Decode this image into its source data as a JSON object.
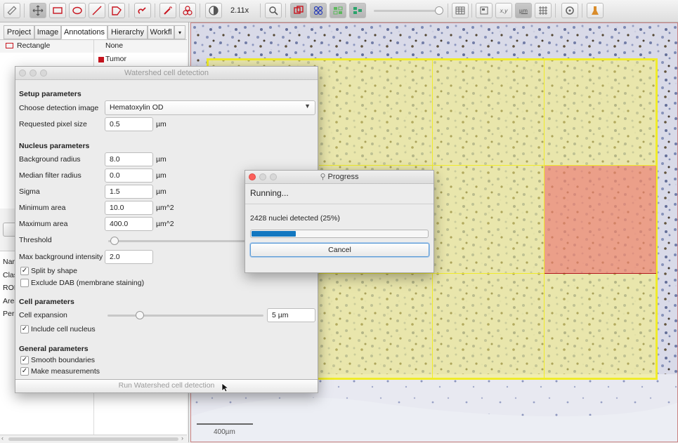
{
  "toolbar": {
    "zoom_label": "2.11x",
    "coord_label": "x,y",
    "unit_label": "µm",
    "icons": [
      "ruler-icon",
      "move-icon",
      "rectangle-icon",
      "ellipse-icon",
      "line-icon",
      "polygon-icon",
      "brush-icon",
      "wand-icon",
      "cells-icon",
      "contrast-icon",
      "zoom-icon",
      "overlay-fill-icon",
      "overlay-detect-icon",
      "overlay-grid-icon",
      "overlay-cells-icon",
      "table-icon",
      "slide-icon",
      "coordinates-icon",
      "scale-icon",
      "grid-icon",
      "settings-icon",
      "log-icon"
    ]
  },
  "left_panel": {
    "tabs": [
      "Project",
      "Image",
      "Annotations",
      "Hierarchy",
      "Workfl"
    ],
    "active_tab": "Annotations",
    "annotation_list": [
      {
        "name": "Rectangle"
      }
    ],
    "class_list": [
      {
        "name": "None",
        "color": ""
      },
      {
        "name": "Tumor",
        "color": "#c8141e"
      }
    ],
    "measurement_stubs": [
      "Nam",
      "Clas",
      "ROI",
      "Area",
      "Peri"
    ]
  },
  "viewer": {
    "scalebar_label": "400µm"
  },
  "watershed_dialog": {
    "title": "Watershed cell detection",
    "sections": {
      "setup": "Setup parameters",
      "nucleus": "Nucleus parameters",
      "cell": "Cell parameters",
      "general": "General parameters"
    },
    "detection_image": {
      "label": "Choose detection image",
      "value": "Hematoxylin OD"
    },
    "pixel_size": {
      "label": "Requested pixel size",
      "value": "0.5",
      "unit": "µm"
    },
    "background_radius": {
      "label": "Background radius",
      "value": "8.0",
      "unit": "µm"
    },
    "median_filter": {
      "label": "Median filter radius",
      "value": "0.0",
      "unit": "µm"
    },
    "sigma": {
      "label": "Sigma",
      "value": "1.5",
      "unit": "µm"
    },
    "min_area": {
      "label": "Minimum area",
      "value": "10.0",
      "unit": "µm^2"
    },
    "max_area": {
      "label": "Maximum area",
      "value": "400.0",
      "unit": "µm^2"
    },
    "threshold": {
      "label": "Threshold"
    },
    "max_bg_intensity": {
      "label": "Max background intensity",
      "value": "2.0"
    },
    "split_by_shape": {
      "label": "Split by shape",
      "checked": true
    },
    "exclude_dab": {
      "label": "Exclude DAB (membrane staining)",
      "checked": false
    },
    "cell_expansion": {
      "label": "Cell expansion",
      "value": "5 µm"
    },
    "include_nucleus": {
      "label": "Include cell nucleus",
      "checked": true
    },
    "smooth_boundaries": {
      "label": "Smooth boundaries",
      "checked": true
    },
    "make_measurements": {
      "label": "Make measurements",
      "checked": true
    },
    "run_button": "Run Watershed cell detection"
  },
  "progress_dialog": {
    "title": "Progress",
    "status": "Running...",
    "message": "2428 nuclei detected (25%)",
    "progress": 0.25,
    "cancel_label": "Cancel"
  },
  "check_mark": "✓",
  "colors": {
    "tile_fill": "#f5f07a",
    "tile_border": "#f0ec2a",
    "active_tile": "#ec8a8e",
    "progress_fill": "#1277c0",
    "tumor": "#c8141e"
  }
}
